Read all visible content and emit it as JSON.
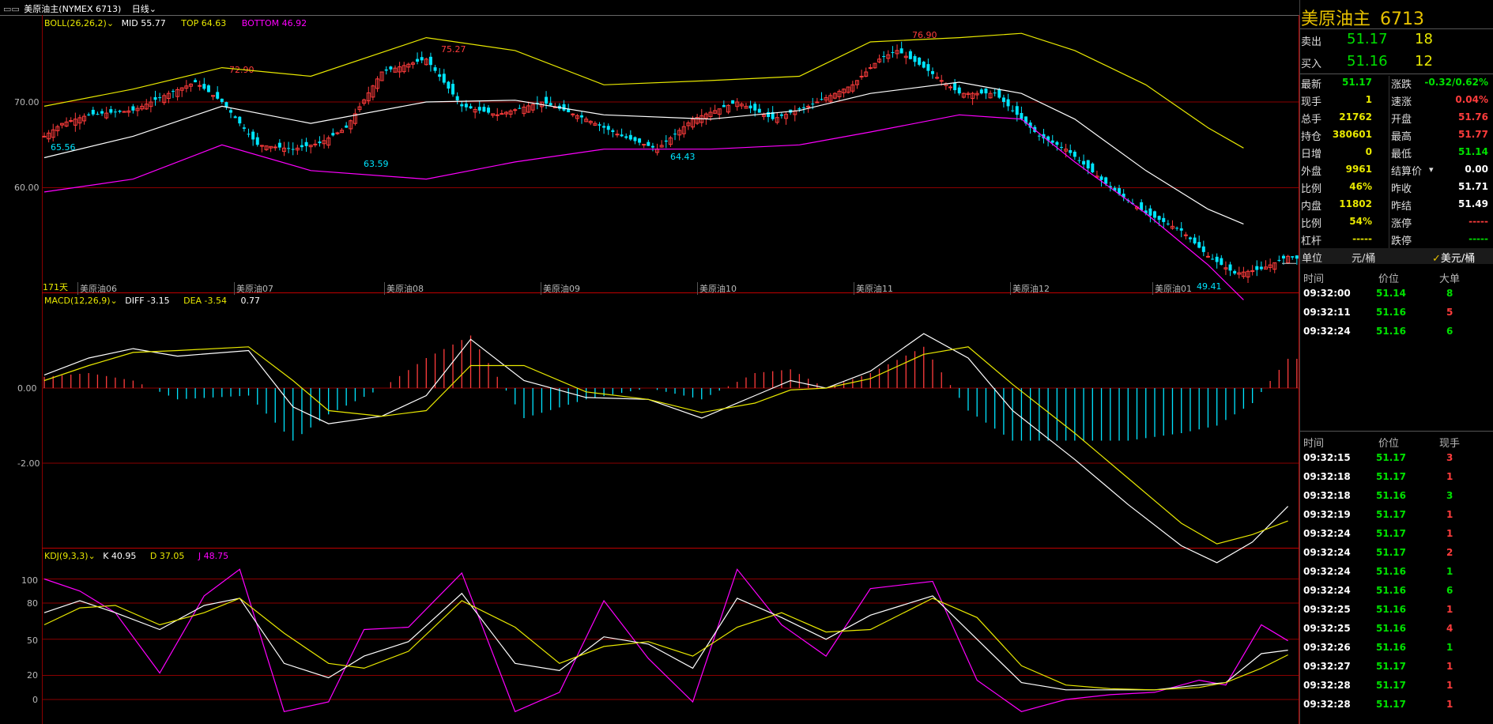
{
  "titlebar": {
    "symbol": "美原油主(NYMEX 6713)",
    "period": "日线",
    "chevron": "chevron-down-icon"
  },
  "boll_legend": {
    "name": "BOLL(26,26,2)",
    "mid": "MID 55.77",
    "top": "TOP 64.63",
    "bottom": "BOTTOM 46.92"
  },
  "macd_legend": {
    "name": "MACD(12,26,9)",
    "diff": "DIFF -3.15",
    "dea": "DEA -3.54",
    "macd": "0.77"
  },
  "kdj_legend": {
    "name": "KDJ(9,3,3)",
    "k": "K 40.95",
    "d": "D 37.05",
    "j": "J 48.75"
  },
  "days_label": "171天",
  "month_labels": [
    "美原油06",
    "美原油07",
    "美原油08",
    "美原油09",
    "美原油10",
    "美原油11",
    "美原油12",
    "美原油01"
  ],
  "price_ticks": [
    "70.00",
    "60.00"
  ],
  "macd_ticks": [
    "0.00",
    "-2.00"
  ],
  "kdj_ticks": [
    "100",
    "80",
    "50",
    "20",
    "0"
  ],
  "annotations": {
    "a1": "65.56",
    "a2": "72.90",
    "a3": "63.59",
    "a4": "75.27",
    "a5": "64.43",
    "a6": "76.90",
    "a7": "49.41"
  },
  "panel": {
    "title": "美原油主",
    "code": "6713",
    "sell_label": "卖出",
    "sell_price": "51.17",
    "sell_vol": "18",
    "buy_label": "买入",
    "buy_price": "51.16",
    "buy_vol": "12",
    "stats_left": [
      {
        "label": "最新",
        "value": "51.17",
        "cls": "green"
      },
      {
        "label": "现手",
        "value": "1",
        "cls": "yellow"
      },
      {
        "label": "总手",
        "value": "21762",
        "cls": "yellow"
      },
      {
        "label": "持仓",
        "value": "380601",
        "cls": "yellow"
      },
      {
        "label": "日增",
        "value": "0",
        "cls": "yellow"
      },
      {
        "label": "外盘",
        "value": "9961",
        "cls": "yellow"
      },
      {
        "label": "比例",
        "value": "46%",
        "cls": "yellow"
      },
      {
        "label": "内盘",
        "value": "11802",
        "cls": "yellow"
      },
      {
        "label": "比例",
        "value": "54%",
        "cls": "yellow"
      },
      {
        "label": "杠杆",
        "value": "-----",
        "cls": "yellow"
      }
    ],
    "stats_right": [
      {
        "label": "涨跌",
        "value": "-0.32/0.62%",
        "cls": "green"
      },
      {
        "label": "速涨",
        "value": "0.04%",
        "cls": "red"
      },
      {
        "label": "开盘",
        "value": "51.76",
        "cls": "red"
      },
      {
        "label": "最高",
        "value": "51.77",
        "cls": "red"
      },
      {
        "label": "最低",
        "value": "51.14",
        "cls": "green"
      },
      {
        "label": "结算价",
        "value": "0.00",
        "cls": "white"
      },
      {
        "label": "昨收",
        "value": "51.71",
        "cls": "white"
      },
      {
        "label": "昨结",
        "value": "51.49",
        "cls": "white"
      },
      {
        "label": "涨停",
        "value": "-----",
        "cls": "red"
      },
      {
        "label": "跌停",
        "value": "-----",
        "cls": "green"
      }
    ],
    "unit_label": "单位",
    "unit_cny": "元/桶",
    "unit_usd": "美元/桶",
    "big_headers": [
      "时间",
      "价位",
      "大单"
    ],
    "big_orders": [
      {
        "time": "09:32:00",
        "price": "51.14",
        "vol": "8",
        "vcls": "green"
      },
      {
        "time": "09:32:11",
        "price": "51.16",
        "vol": "5",
        "vcls": "red"
      },
      {
        "time": "09:32:24",
        "price": "51.16",
        "vol": "6",
        "vcls": "green"
      }
    ],
    "tick_headers": [
      "时间",
      "价位",
      "现手"
    ],
    "ticks": [
      {
        "time": "09:32:15",
        "price": "51.17",
        "vol": "3",
        "vcls": "red"
      },
      {
        "time": "09:32:18",
        "price": "51.17",
        "vol": "1",
        "vcls": "red"
      },
      {
        "time": "09:32:18",
        "price": "51.16",
        "vol": "3",
        "vcls": "green"
      },
      {
        "time": "09:32:19",
        "price": "51.17",
        "vol": "1",
        "vcls": "red"
      },
      {
        "time": "09:32:24",
        "price": "51.17",
        "vol": "1",
        "vcls": "red"
      },
      {
        "time": "09:32:24",
        "price": "51.17",
        "vol": "2",
        "vcls": "red"
      },
      {
        "time": "09:32:24",
        "price": "51.16",
        "vol": "1",
        "vcls": "green"
      },
      {
        "time": "09:32:24",
        "price": "51.16",
        "vol": "6",
        "vcls": "green"
      },
      {
        "time": "09:32:25",
        "price": "51.16",
        "vol": "1",
        "vcls": "red"
      },
      {
        "time": "09:32:25",
        "price": "51.16",
        "vol": "4",
        "vcls": "red"
      },
      {
        "time": "09:32:26",
        "price": "51.16",
        "vol": "1",
        "vcls": "green"
      },
      {
        "time": "09:32:27",
        "price": "51.17",
        "vol": "1",
        "vcls": "red"
      },
      {
        "time": "09:32:28",
        "price": "51.17",
        "vol": "1",
        "vcls": "red"
      },
      {
        "time": "09:32:28",
        "price": "51.17",
        "vol": "1",
        "vcls": "red"
      }
    ]
  },
  "colors": {
    "up": "#ff3c3c",
    "down": "#00e5ff",
    "mid": "#ffffff",
    "upper": "#e8e800",
    "lower": "#ff00ff",
    "grid": "#8a0000"
  },
  "chart_data": {
    "type": "line",
    "candles": {
      "anchors": [
        [
          0,
          66
        ],
        [
          4,
          67.5
        ],
        [
          10,
          68.5
        ],
        [
          20,
          69
        ],
        [
          28,
          71
        ],
        [
          34,
          72.3
        ],
        [
          40,
          70
        ],
        [
          48,
          65
        ],
        [
          56,
          64.5
        ],
        [
          62,
          65.2
        ],
        [
          68,
          67
        ],
        [
          76,
          73.5
        ],
        [
          86,
          75
        ],
        [
          94,
          69.5
        ],
        [
          102,
          68.5
        ],
        [
          112,
          70
        ],
        [
          122,
          68
        ],
        [
          130,
          66
        ],
        [
          138,
          64.5
        ],
        [
          146,
          68
        ],
        [
          156,
          70
        ],
        [
          164,
          68
        ],
        [
          172,
          69.5
        ],
        [
          182,
          72
        ],
        [
          188,
          75
        ],
        [
          192,
          76
        ],
        [
          198,
          74
        ],
        [
          206,
          71
        ],
        [
          214,
          71
        ],
        [
          224,
          66
        ],
        [
          230,
          64.5
        ],
        [
          240,
          60
        ],
        [
          248,
          57
        ],
        [
          256,
          55
        ],
        [
          262,
          52
        ],
        [
          268,
          50
        ],
        [
          274,
          50.5
        ],
        [
          280,
          52
        ],
        [
          286,
          51.2
        ]
      ],
      "high": 76.9,
      "low": 49.41
    },
    "boll": {
      "upper": [
        [
          0,
          69.5
        ],
        [
          20,
          71.5
        ],
        [
          40,
          74
        ],
        [
          60,
          73
        ],
        [
          86,
          77.5
        ],
        [
          106,
          76
        ],
        [
          126,
          72
        ],
        [
          150,
          72.5
        ],
        [
          170,
          73
        ],
        [
          186,
          77
        ],
        [
          206,
          77.5
        ],
        [
          220,
          78
        ],
        [
          232,
          76
        ],
        [
          248,
          72
        ],
        [
          262,
          67
        ],
        [
          270,
          64.63
        ]
      ],
      "mid": [
        [
          0,
          63.5
        ],
        [
          20,
          66
        ],
        [
          40,
          69.5
        ],
        [
          60,
          67.5
        ],
        [
          86,
          70
        ],
        [
          106,
          70.2
        ],
        [
          126,
          68.5
        ],
        [
          150,
          68
        ],
        [
          170,
          69
        ],
        [
          186,
          71
        ],
        [
          206,
          72.3
        ],
        [
          220,
          71
        ],
        [
          232,
          68
        ],
        [
          248,
          62
        ],
        [
          262,
          57.5
        ],
        [
          270,
          55.77
        ]
      ],
      "lower": [
        [
          0,
          59.5
        ],
        [
          20,
          61
        ],
        [
          40,
          65
        ],
        [
          60,
          62
        ],
        [
          86,
          61
        ],
        [
          106,
          63
        ],
        [
          126,
          64.5
        ],
        [
          150,
          64.5
        ],
        [
          170,
          65
        ],
        [
          186,
          66.5
        ],
        [
          206,
          68.5
        ],
        [
          220,
          68
        ],
        [
          232,
          63
        ],
        [
          248,
          57
        ],
        [
          262,
          51
        ],
        [
          270,
          46.92
        ]
      ]
    },
    "macd": {
      "diff": [
        [
          0,
          0.35
        ],
        [
          10,
          0.8
        ],
        [
          20,
          1.05
        ],
        [
          30,
          0.85
        ],
        [
          46,
          1.0
        ],
        [
          56,
          -0.5
        ],
        [
          64,
          -0.95
        ],
        [
          76,
          -0.75
        ],
        [
          86,
          -0.2
        ],
        [
          96,
          1.3
        ],
        [
          108,
          0.2
        ],
        [
          122,
          -0.25
        ],
        [
          136,
          -0.3
        ],
        [
          148,
          -0.8
        ],
        [
          160,
          -0.2
        ],
        [
          168,
          0.2
        ],
        [
          176,
          0.0
        ],
        [
          186,
          0.45
        ],
        [
          198,
          1.45
        ],
        [
          208,
          0.8
        ],
        [
          218,
          -0.6
        ],
        [
          232,
          -1.9
        ],
        [
          244,
          -3.1
        ],
        [
          256,
          -4.2
        ],
        [
          264,
          -4.65
        ],
        [
          272,
          -4.1
        ],
        [
          280,
          -3.15
        ]
      ],
      "dea": [
        [
          0,
          0.2
        ],
        [
          10,
          0.6
        ],
        [
          20,
          0.95
        ],
        [
          30,
          1.0
        ],
        [
          46,
          1.1
        ],
        [
          56,
          0.2
        ],
        [
          64,
          -0.6
        ],
        [
          76,
          -0.75
        ],
        [
          86,
          -0.6
        ],
        [
          96,
          0.6
        ],
        [
          108,
          0.6
        ],
        [
          122,
          -0.1
        ],
        [
          136,
          -0.3
        ],
        [
          148,
          -0.65
        ],
        [
          160,
          -0.4
        ],
        [
          168,
          -0.05
        ],
        [
          176,
          0.0
        ],
        [
          186,
          0.25
        ],
        [
          198,
          0.9
        ],
        [
          208,
          1.1
        ],
        [
          218,
          0.1
        ],
        [
          232,
          -1.2
        ],
        [
          244,
          -2.4
        ],
        [
          256,
          -3.6
        ],
        [
          264,
          -4.15
        ],
        [
          272,
          -3.9
        ],
        [
          280,
          -3.54
        ]
      ]
    },
    "kdj": {
      "k": [
        [
          0,
          72
        ],
        [
          8,
          82
        ],
        [
          16,
          72
        ],
        [
          26,
          58
        ],
        [
          36,
          78
        ],
        [
          44,
          84
        ],
        [
          54,
          30
        ],
        [
          64,
          18
        ],
        [
          72,
          36
        ],
        [
          82,
          48
        ],
        [
          94,
          88
        ],
        [
          106,
          30
        ],
        [
          116,
          24
        ],
        [
          126,
          52
        ],
        [
          136,
          46
        ],
        [
          146,
          26
        ],
        [
          156,
          84
        ],
        [
          166,
          68
        ],
        [
          176,
          50
        ],
        [
          186,
          70
        ],
        [
          200,
          86
        ],
        [
          210,
          50
        ],
        [
          220,
          14
        ],
        [
          230,
          8
        ],
        [
          240,
          8
        ],
        [
          250,
          8
        ],
        [
          260,
          12
        ],
        [
          266,
          14
        ],
        [
          274,
          38
        ],
        [
          280,
          40.95
        ]
      ],
      "d": [
        [
          0,
          62
        ],
        [
          8,
          76
        ],
        [
          16,
          78
        ],
        [
          26,
          62
        ],
        [
          36,
          72
        ],
        [
          44,
          84
        ],
        [
          54,
          55
        ],
        [
          64,
          30
        ],
        [
          72,
          26
        ],
        [
          82,
          40
        ],
        [
          94,
          82
        ],
        [
          106,
          60
        ],
        [
          116,
          30
        ],
        [
          126,
          44
        ],
        [
          136,
          48
        ],
        [
          146,
          36
        ],
        [
          156,
          60
        ],
        [
          166,
          72
        ],
        [
          176,
          56
        ],
        [
          186,
          58
        ],
        [
          200,
          84
        ],
        [
          210,
          68
        ],
        [
          220,
          28
        ],
        [
          230,
          12
        ],
        [
          240,
          9
        ],
        [
          250,
          8
        ],
        [
          260,
          10
        ],
        [
          266,
          14
        ],
        [
          274,
          26
        ],
        [
          280,
          37.05
        ]
      ],
      "j": [
        [
          0,
          100
        ],
        [
          8,
          90
        ],
        [
          16,
          72
        ],
        [
          26,
          22
        ],
        [
          36,
          86
        ],
        [
          44,
          108
        ],
        [
          54,
          -10
        ],
        [
          64,
          -2
        ],
        [
          72,
          58
        ],
        [
          82,
          60
        ],
        [
          94,
          105
        ],
        [
          106,
          -10
        ],
        [
          116,
          6
        ],
        [
          126,
          82
        ],
        [
          136,
          34
        ],
        [
          146,
          -2
        ],
        [
          156,
          108
        ],
        [
          166,
          62
        ],
        [
          176,
          36
        ],
        [
          186,
          92
        ],
        [
          200,
          98
        ],
        [
          210,
          16
        ],
        [
          220,
          -10
        ],
        [
          230,
          0
        ],
        [
          240,
          4
        ],
        [
          250,
          6
        ],
        [
          260,
          16
        ],
        [
          266,
          12
        ],
        [
          274,
          62
        ],
        [
          280,
          48.75
        ]
      ]
    },
    "n_bars": 283
  }
}
